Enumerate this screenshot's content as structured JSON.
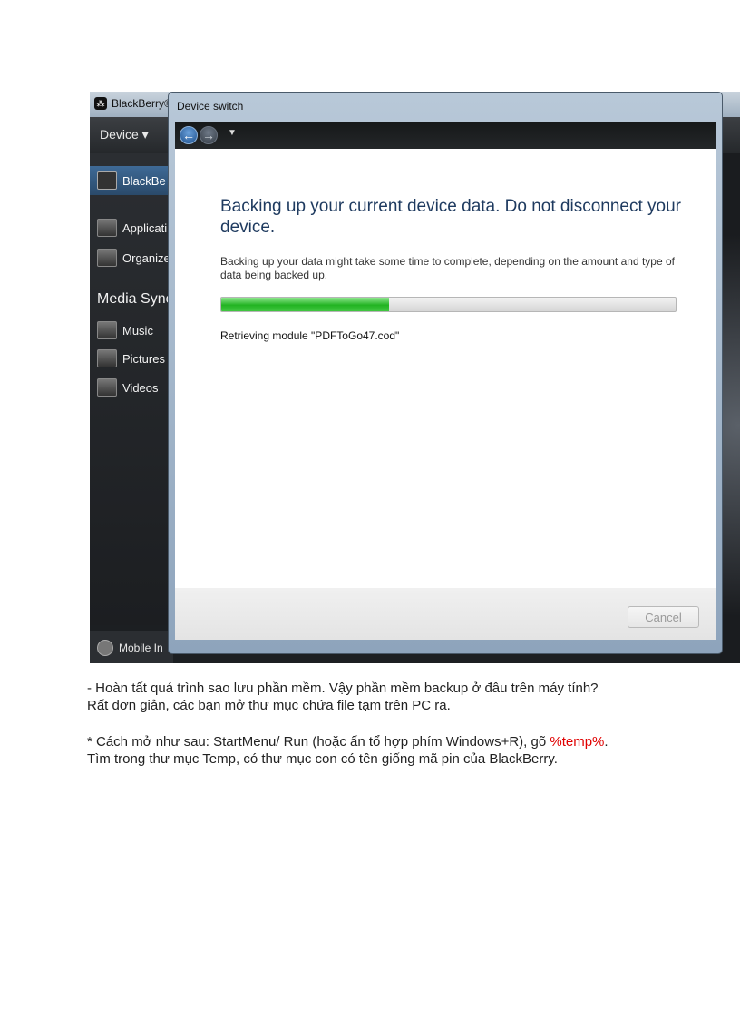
{
  "app": {
    "title": "BlackBerry®",
    "logo_icon": "blackberry-logo-icon",
    "device_menu": "Device ▾",
    "sidebar": {
      "items": [
        {
          "label": "BlackBe",
          "icon": "blackberry-icon",
          "active": true
        },
        {
          "label": "Applicati",
          "icon": "applications-icon"
        },
        {
          "label": "Organize",
          "icon": "organizer-icon"
        }
      ],
      "media_heading": "Media Sync",
      "media_items": [
        {
          "label": "Music",
          "icon": "music-icon"
        },
        {
          "label": "Pictures",
          "icon": "pictures-icon"
        },
        {
          "label": "Videos",
          "icon": "videos-icon"
        }
      ],
      "bottom_item": {
        "label": "Mobile In",
        "icon": "mobile-internet-icon"
      }
    }
  },
  "dialog": {
    "title": "Device switch",
    "nav": {
      "back_icon": "back-arrow-icon",
      "forward_icon": "forward-arrow-icon",
      "dropdown_icon": "chevron-down-icon"
    },
    "heading": "Backing up your current device data. Do not disconnect your device.",
    "description": "Backing up your data might take some time to complete, depending on the amount and type of data being backed up.",
    "progress_percent": 37,
    "status": "Retrieving module \"PDFToGo47.cod\"",
    "cancel_label": "Cancel",
    "colors": {
      "progress_fill": "#22b322",
      "heading": "#1e3a5f"
    }
  },
  "article": {
    "line1": "- Hoàn tất quá trình sao lưu phần mềm. Vậy phần mềm backup ở đâu trên máy tính?",
    "line2": "Rất đơn giản, các bạn mở thư mục chứa file tạm trên PC ra.",
    "line3_prefix": "* Cách mở như sau: StartMenu/ Run (hoặc ấn tổ hợp phím Windows+R), gõ ",
    "line3_highlight": "%temp%",
    "line3_suffix": ".",
    "line4": "Tìm trong thư mục Temp, có thư mục con có tên giống mã pin của BlackBerry.",
    "highlight_color": "#e00000"
  }
}
